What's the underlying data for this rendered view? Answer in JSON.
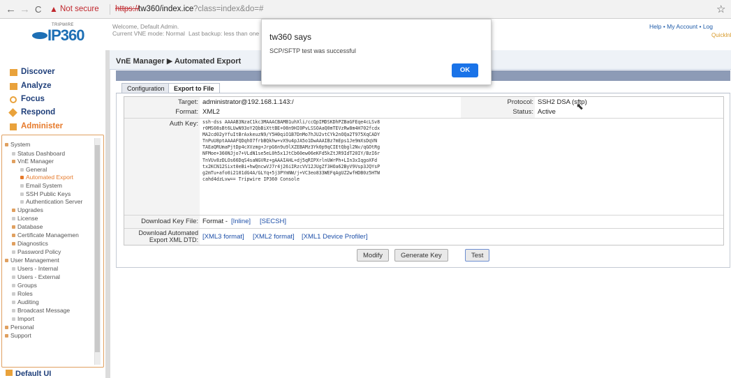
{
  "browser": {
    "back": "←",
    "forward": "→",
    "reload": "C",
    "warning_icon": "▲",
    "security_label": "Not secure",
    "url_scheme": "https://",
    "url_host_path": "tw360/index.ice",
    "url_query": "?class=index&do=#",
    "star": "☆"
  },
  "header": {
    "logo_small": "TRIPWIRE",
    "logo_text": "IP360",
    "welcome": "Welcome, Default Admin.",
    "vne_mode": "Current VNE mode: Normal",
    "last_backup": "Last backup: less than one",
    "links": "Help • My Account • Log",
    "quicklink": "Quicklnl"
  },
  "sidebar": {
    "items": [
      {
        "label": "Discover",
        "icon": "discover-icon"
      },
      {
        "label": "Analyze",
        "icon": "analyze-icon"
      },
      {
        "label": "Focus",
        "icon": "focus-icon"
      },
      {
        "label": "Respond",
        "icon": "respond-icon"
      },
      {
        "label": "Administer",
        "icon": "administer-icon"
      }
    ],
    "tree": [
      {
        "label": "System",
        "level": 0
      },
      {
        "label": "Status Dashboard",
        "level": 1
      },
      {
        "label": "VnE Manager",
        "level": 1
      },
      {
        "label": "General",
        "level": 2
      },
      {
        "label": "Automated Export",
        "level": 2,
        "selected": true
      },
      {
        "label": "Email System",
        "level": 2
      },
      {
        "label": "SSH Public Keys",
        "level": 2
      },
      {
        "label": "Authentication Server",
        "level": 2
      },
      {
        "label": "Upgrades",
        "level": 1
      },
      {
        "label": "License",
        "level": 1
      },
      {
        "label": "Database",
        "level": 1
      },
      {
        "label": "Certificate Managemen",
        "level": 1
      },
      {
        "label": "Diagnostics",
        "level": 1
      },
      {
        "label": "Password Policy",
        "level": 1
      },
      {
        "label": "User Management",
        "level": 0
      },
      {
        "label": "Users - Internal",
        "level": 1
      },
      {
        "label": "Users - External",
        "level": 1
      },
      {
        "label": "Groups",
        "level": 1
      },
      {
        "label": "Roles",
        "level": 1
      },
      {
        "label": "Auditing",
        "level": 1
      },
      {
        "label": "Broadcast Message",
        "level": 1
      },
      {
        "label": "Import",
        "level": 1
      },
      {
        "label": "Personal",
        "level": 0
      },
      {
        "label": "Support",
        "level": 0
      }
    ],
    "default_ui": "Default UI"
  },
  "main": {
    "breadcrumb": "VnE Manager ▶ Automated Export",
    "tabs": [
      {
        "label": "Configuration",
        "active": false
      },
      {
        "label": "Export to File",
        "active": true
      }
    ],
    "target_label": "Target:",
    "target_value": "administrator@192.168.1.143:/",
    "format_label": "Format:",
    "format_value": "XML2",
    "protocol_label": "Protocol:",
    "protocol_value": "SSH2 DSA (sftp)",
    "status_label": "Status:",
    "status_value": "Active",
    "authkey_label": "Auth Key:",
    "authkey_value": "ssh-dss AAAAB3NzaC1kc3MAAACBAMB1uhXli/ccQpIMDSKDhPZBaGFEqe4cLSv8\nr0MS08sBt6LUwN93oY2QbBiXttBE+08n9HI0PvLSSOAaQ0mTEVzRw8m4H702fcdx\nMA2cd02yYfuItBrAxkeuzN9/Y5H0qiO1B7DnMo7hJU2vtCYk2nOQa2T975XqCADY\nTnPuU8ptAAAAFQDqhO7frbBQkhw+vX9u4pJA5o1DwAAAIBz7mEps1Je9mXsDqVN\nTAEaQRUmaPjtDp4cXVzmg+JrpG6n9u9lXZEBAMz3Yk0p9qCIEtQbgl2Nv/qGOtRg\nNFMoe+360NJjo7+VLdN1se5eL0h5x1JtCb60ew06eKFd5kZtJR9IdT20IY/BzI6r\nTnVUv8zDLOs66DqS4saNGVRz+gAAAIAHL+dj5qRIPXrlnUWrPh+LIn3xIqgoXFd\ntx2KCN12Sixt0eBi+hwQncwVJ7r4j26iIRzcVV12JUgZf3HOa62ByV9Vsp3JQYsP\ng2mTu+afo0i2101dG4A/GLYq+5j3PYmNW/j+VC3eo833WEFqAgUZ2wfHDB0z5HTW\ncahd4dzLvw== Tripwire IP360 Console",
    "download_key_label": "Download Key File:",
    "download_key_format": "Format -",
    "download_key_inline": "[Inline]",
    "download_key_secsh": "[SECSH]",
    "dtd_label_1": "Download Automated",
    "dtd_label_2": "Export XML DTD:",
    "dtd_xml3": "[XML3 format]",
    "dtd_xml2": "[XML2 format]",
    "dtd_xml1": "[XML1 Device Profiler]",
    "btn_modify": "Modify",
    "btn_generate": "Generate Key",
    "btn_test": "Test"
  },
  "dialog": {
    "title": "tw360 says",
    "message": "SCP/SFTP test was successful",
    "ok": "OK"
  },
  "colors": {
    "accent": "#1d6fb5",
    "dialog_button": "#1a73e8",
    "selected_tree": "#e67a2b",
    "warning": "#c0272d"
  }
}
